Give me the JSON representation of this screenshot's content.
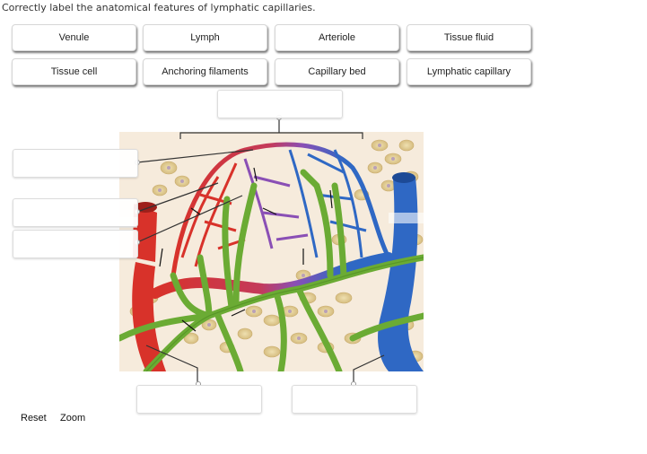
{
  "instructions": "Correctly label the anatomical features of lymphatic capillaries.",
  "label_bank": [
    {
      "label": "Venule"
    },
    {
      "label": "Lymph"
    },
    {
      "label": "Arteriole"
    },
    {
      "label": "Tissue fluid"
    },
    {
      "label": "Tissue cell"
    },
    {
      "label": "Anchoring filaments"
    },
    {
      "label": "Capillary bed"
    },
    {
      "label": "Lymphatic capillary"
    }
  ],
  "drop_zones": [
    {
      "id": "top-bracket",
      "value": ""
    },
    {
      "id": "left-1",
      "value": ""
    },
    {
      "id": "left-2",
      "value": ""
    },
    {
      "id": "left-3",
      "value": ""
    },
    {
      "id": "bottom-1",
      "value": ""
    },
    {
      "id": "bottom-2",
      "value": ""
    }
  ],
  "figure": {
    "subject": "lymphatic capillaries among blood capillary bed",
    "colors": {
      "background": "#f6ebdc",
      "arterial": "#d8322a",
      "venous": "#2f68c4",
      "mixed": "#8a4fb5",
      "lymphatic": "#6bab34",
      "tissue_cell": "#e3cf96",
      "nucleus": "#b9a0b8"
    }
  },
  "footer": {
    "reset": "Reset",
    "zoom": "Zoom"
  }
}
